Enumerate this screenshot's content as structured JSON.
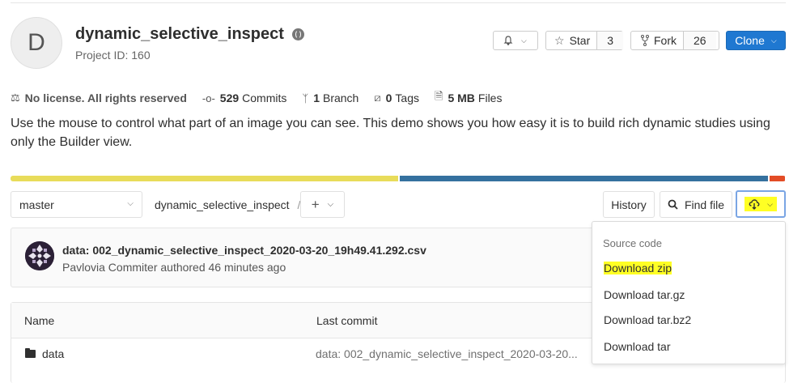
{
  "project": {
    "avatar_letter": "D",
    "name": "dynamic_selective_inspect",
    "id_text": "Project ID: 160"
  },
  "actions": {
    "star_label": "Star",
    "star_count": "3",
    "fork_label": "Fork",
    "fork_count": "26",
    "clone_label": "Clone"
  },
  "stats": {
    "license": "No license. All rights reserved",
    "commits_count": "529",
    "commits_label": "Commits",
    "branches_count": "1",
    "branches_label": "Branch",
    "tags_count": "0",
    "tags_label": "Tags",
    "files_size": "5 MB",
    "files_label": "Files"
  },
  "description": "Use the mouse to control what part of an image you can see. This demo shows you how easy it is to build rich dynamic studies using only the Builder view.",
  "language_bar": [
    {
      "color": "#e8dc5a",
      "fraction": 0.5
    },
    {
      "color": "#35719f",
      "fraction": 0.475
    },
    {
      "color": "#e34c26",
      "fraction": 0.02
    }
  ],
  "repo_nav": {
    "branch": "master",
    "path": "dynamic_selective_inspect",
    "separator": "/",
    "add": "+",
    "history": "History",
    "find_file": "Find file"
  },
  "last_commit": {
    "message": "data: 002_dynamic_selective_inspect_2020-03-20_19h49.41.292.csv",
    "author_line": "Pavlovia Commiter authored 46 minutes ago"
  },
  "file_table": {
    "col_name": "Name",
    "col_last_commit": "Last commit",
    "rows": [
      {
        "name": "data",
        "last_commit": "data: 002_dynamic_selective_inspect_2020-03-20..."
      }
    ]
  },
  "download_menu": {
    "header": "Source code",
    "items": [
      "Download zip",
      "Download tar.gz",
      "Download tar.bz2",
      "Download tar"
    ],
    "highlighted": "Download zip"
  },
  "colors": {
    "clone_button": "#1f78d1",
    "highlight": "#ffff24"
  }
}
